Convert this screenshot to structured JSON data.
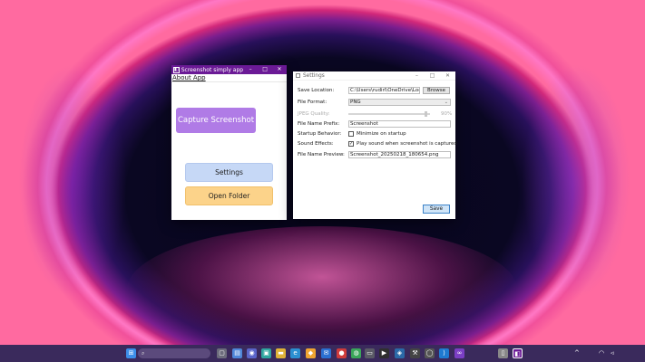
{
  "app_window": {
    "title": "Screenshot simply app",
    "controls": {
      "minimize": "–",
      "maximize": "□",
      "close": "✕"
    },
    "menu": {
      "about": "About App"
    },
    "buttons": {
      "capture": "Capture Screenshot",
      "settings": "Settings",
      "open_folder": "Open Folder"
    },
    "colors": {
      "titlebar": "#6b1a96",
      "capture": "#b07be6",
      "settings": "#c6d8f6",
      "open_folder": "#fcd38a"
    }
  },
  "settings_window": {
    "title": "Settings",
    "controls": {
      "minimize": "–",
      "maximize": "□",
      "close": "✕"
    },
    "fields": {
      "save_location": {
        "label": "Save Location:",
        "value": "C:\\Users\\rudirl\\OneDrive\\Locion",
        "browse": "Browse"
      },
      "file_format": {
        "label": "File Format:",
        "value": "PNG"
      },
      "jpeg_quality": {
        "label": "JPEG Quality:",
        "value": "90%",
        "level": 0.9
      },
      "prefix": {
        "label": "File Name Prefix:",
        "value": "Screenshot"
      },
      "startup": {
        "label": "Startup Behavior:",
        "option": "Minimize on startup",
        "checked": false
      },
      "sound": {
        "label": "Sound Effects:",
        "option": "Play sound when screenshot is captured",
        "checked": true
      },
      "preview": {
        "label": "File Name Preview:",
        "value": "Screenshot_20250218_180654.png"
      }
    },
    "save": "Save"
  },
  "taskbar": {
    "search_icon": "magnifier-icon",
    "icons": [
      "windows-start-icon",
      "task-view-icon",
      "widgets-icon",
      "chat-icon",
      "file-explorer-icon",
      "edge-icon",
      "store-icon",
      "mail-icon",
      "terminal-icon",
      "vscode-icon",
      "visual-studio-icon",
      "app-icon",
      "screenshot-app-icon"
    ],
    "tray": [
      "chevron-up-icon",
      "wifi-icon",
      "volume-icon"
    ],
    "color": "#3a2a5c"
  }
}
